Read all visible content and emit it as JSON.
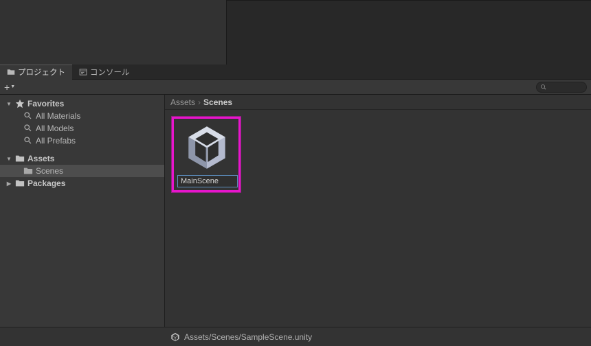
{
  "tabs": {
    "project": "プロジェクト",
    "console": "コンソール"
  },
  "sidebar": {
    "favorites": {
      "label": "Favorites",
      "items": [
        "All Materials",
        "All Models",
        "All Prefabs"
      ]
    },
    "assets": {
      "label": "Assets",
      "children": [
        "Scenes"
      ]
    },
    "packages": {
      "label": "Packages"
    }
  },
  "breadcrumb": {
    "root": "Assets",
    "current": "Scenes"
  },
  "asset": {
    "rename_value": "MainScene"
  },
  "status": {
    "path": "Assets/Scenes/SampleScene.unity"
  }
}
